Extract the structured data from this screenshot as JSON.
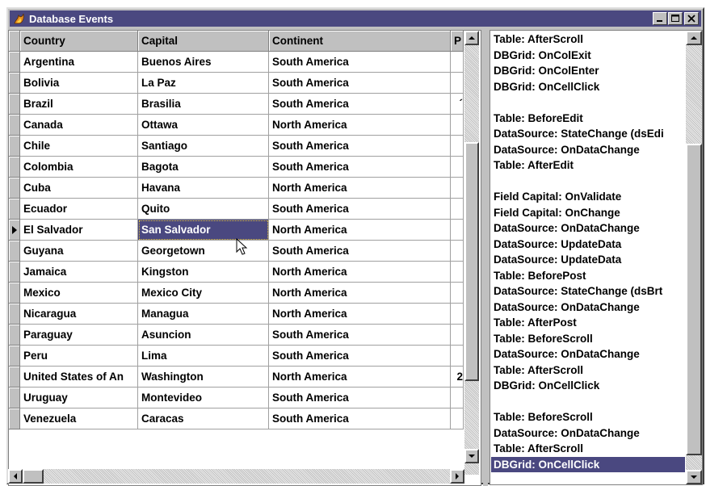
{
  "window": {
    "title": "Database Events"
  },
  "grid": {
    "columns": [
      "Country",
      "Capital",
      "Continent",
      "P"
    ],
    "rows": [
      {
        "country": "Argentina",
        "capital": "Buenos Aires",
        "continent": "South America",
        "p": ""
      },
      {
        "country": "Bolivia",
        "capital": "La Paz",
        "continent": "South America",
        "p": ""
      },
      {
        "country": "Brazil",
        "capital": "Brasilia",
        "continent": "South America",
        "p": "´"
      },
      {
        "country": "Canada",
        "capital": "Ottawa",
        "continent": "North America",
        "p": ""
      },
      {
        "country": "Chile",
        "capital": "Santiago",
        "continent": "South America",
        "p": ""
      },
      {
        "country": "Colombia",
        "capital": "Bagota",
        "continent": "South America",
        "p": ""
      },
      {
        "country": "Cuba",
        "capital": "Havana",
        "continent": "North America",
        "p": ""
      },
      {
        "country": "Ecuador",
        "capital": "Quito",
        "continent": "South America",
        "p": ""
      },
      {
        "country": "El Salvador",
        "capital": "San Salvador",
        "continent": "North America",
        "p": ""
      },
      {
        "country": "Guyana",
        "capital": "Georgetown",
        "continent": "South America",
        "p": ""
      },
      {
        "country": "Jamaica",
        "capital": "Kingston",
        "continent": "North America",
        "p": ""
      },
      {
        "country": "Mexico",
        "capital": "Mexico City",
        "continent": "North America",
        "p": ""
      },
      {
        "country": "Nicaragua",
        "capital": "Managua",
        "continent": "North America",
        "p": ""
      },
      {
        "country": "Paraguay",
        "capital": "Asuncion",
        "continent": "South America",
        "p": ""
      },
      {
        "country": "Peru",
        "capital": "Lima",
        "continent": "South America",
        "p": ""
      },
      {
        "country": "United States of An",
        "capital": "Washington",
        "continent": "North America",
        "p": "2"
      },
      {
        "country": "Uruguay",
        "capital": "Montevideo",
        "continent": "South America",
        "p": ""
      },
      {
        "country": "Venezuela",
        "capital": "Caracas",
        "continent": "South America",
        "p": ""
      }
    ],
    "current_row": 8,
    "selected_cell_row": 8
  },
  "log": {
    "lines": [
      "Table: AfterScroll",
      "DBGrid: OnColExit",
      "DBGrid: OnColEnter",
      "DBGrid: OnCellClick",
      "",
      "Table: BeforeEdit",
      "DataSource: StateChange (dsEdi",
      "DataSource: OnDataChange",
      "Table: AfterEdit",
      "",
      "Field Capital: OnValidate",
      "Field Capital: OnChange",
      "DataSource: OnDataChange",
      "DataSource: UpdateData",
      "DataSource: UpdateData",
      "Table: BeforePost",
      "DataSource: StateChange (dsBrt",
      "DataSource: OnDataChange",
      "Table: AfterPost",
      "Table: BeforeScroll",
      "DataSource: OnDataChange",
      "Table: AfterScroll",
      "DBGrid: OnCellClick",
      "",
      "Table: BeforeScroll",
      "DataSource: OnDataChange",
      "Table: AfterScroll",
      "DBGrid: OnCellClick"
    ],
    "selected_index": 27
  },
  "colors": {
    "titlebar": "#4a4880",
    "selection": "#4a4880",
    "face": "#c0c0c0"
  },
  "icons": {
    "app": "flame-icon",
    "minimize": "minimize-icon",
    "maximize": "maximize-icon",
    "close": "close-icon"
  }
}
